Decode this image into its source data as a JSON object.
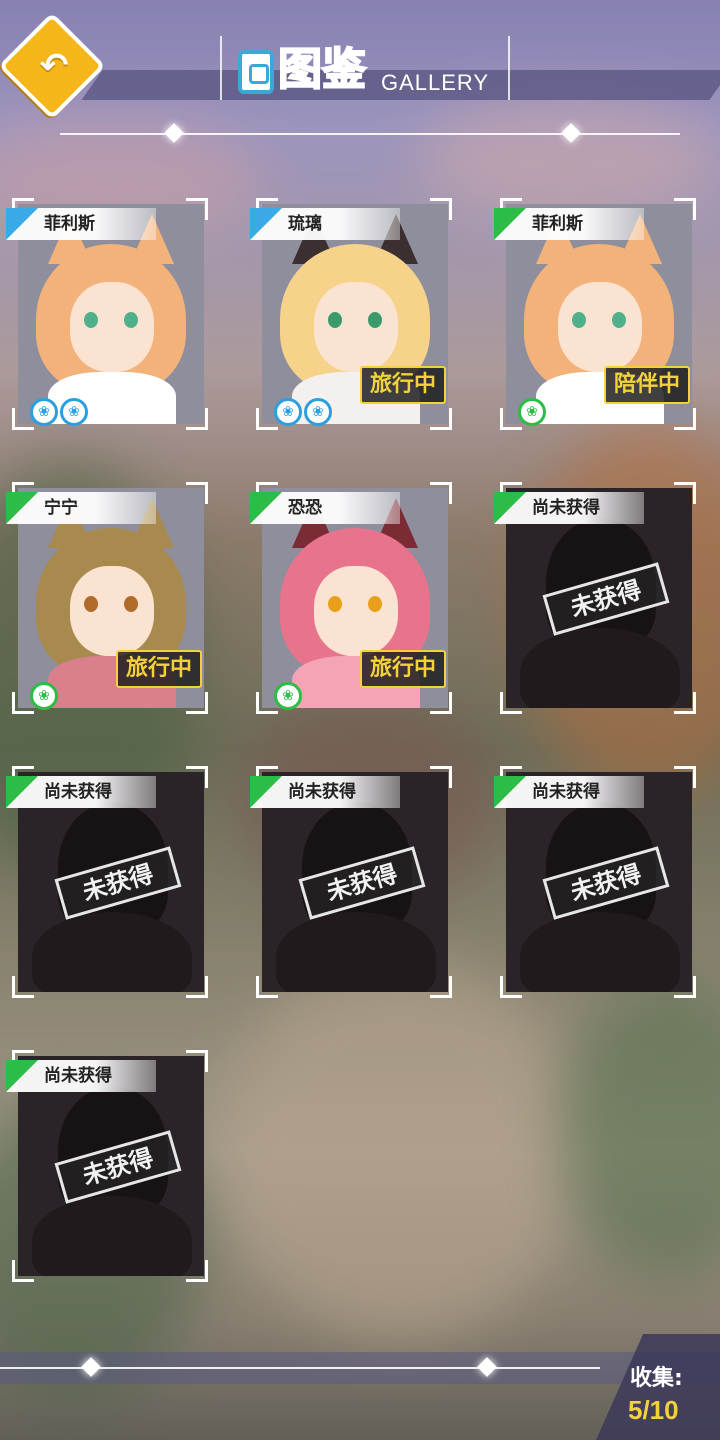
{
  "header": {
    "title_cn": "图鉴",
    "title_en": "GALLERY",
    "back_icon": "back-arrow-icon"
  },
  "cards": [
    {
      "name": "菲利斯",
      "tag_color": "#3aa9e8",
      "status": "",
      "locked": false,
      "paws": 2,
      "paw_color": "#2aa0e0"
    },
    {
      "name": "琉璃",
      "tag_color": "#3aa9e8",
      "status": "旅行中",
      "locked": false,
      "paws": 2,
      "paw_color": "#2aa0e0"
    },
    {
      "name": "菲利斯",
      "tag_color": "#2bbd45",
      "status": "陪伴中",
      "locked": false,
      "paws": 1,
      "paw_color": "#2bbd45"
    },
    {
      "name": "宁宁",
      "tag_color": "#2bbd45",
      "status": "旅行中",
      "locked": false,
      "paws": 1,
      "paw_color": "#2bbd45"
    },
    {
      "name": "恐恐",
      "tag_color": "#2bbd45",
      "status": "旅行中",
      "locked": false,
      "paws": 1,
      "paw_color": "#2bbd45"
    },
    {
      "name": "尚未获得",
      "tag_color": "#2bbd45",
      "status": "未获得",
      "locked": true,
      "paws": 0
    },
    {
      "name": "尚未获得",
      "tag_color": "#2bbd45",
      "status": "未获得",
      "locked": true,
      "paws": 0
    },
    {
      "name": "尚未获得",
      "tag_color": "#2bbd45",
      "status": "未获得",
      "locked": true,
      "paws": 0
    },
    {
      "name": "尚未获得",
      "tag_color": "#2bbd45",
      "status": "未获得",
      "locked": true,
      "paws": 0
    },
    {
      "name": "尚未获得",
      "tag_color": "#2bbd45",
      "status": "未获得",
      "locked": true,
      "paws": 0
    }
  ],
  "footer": {
    "collect_label": "收集:",
    "collect_value": "5/10"
  }
}
